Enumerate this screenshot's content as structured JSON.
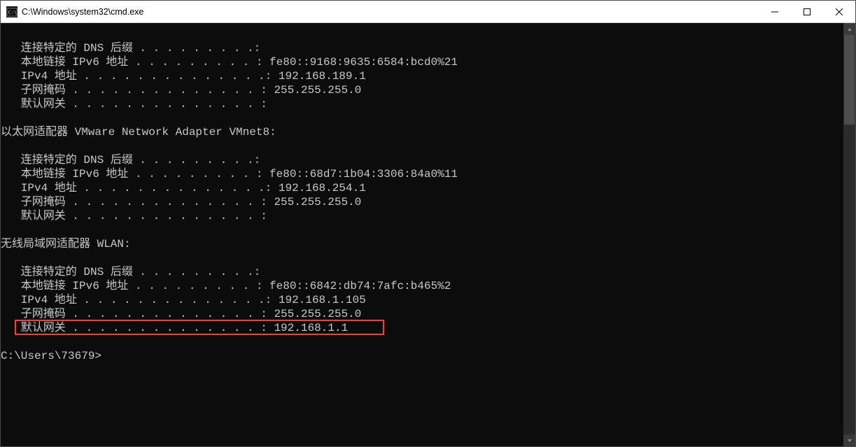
{
  "window": {
    "title": "C:\\Windows\\system32\\cmd.exe"
  },
  "adapters": [
    {
      "header": null,
      "rows": [
        {
          "label": "连接特定的 DNS 后缀",
          "value": ""
        },
        {
          "label": "本地链接 IPv6 地址",
          "value": "fe80::9168:9635:6584:bcd0%21"
        },
        {
          "label": "IPv4 地址",
          "value": "192.168.189.1"
        },
        {
          "label": "子网掩码",
          "value": "255.255.255.0"
        },
        {
          "label": "默认网关",
          "value": ""
        }
      ]
    },
    {
      "header": "以太网适配器 VMware Network Adapter VMnet8:",
      "rows": [
        {
          "label": "连接特定的 DNS 后缀",
          "value": ""
        },
        {
          "label": "本地链接 IPv6 地址",
          "value": "fe80::68d7:1b04:3306:84a0%11"
        },
        {
          "label": "IPv4 地址",
          "value": "192.168.254.1"
        },
        {
          "label": "子网掩码",
          "value": "255.255.255.0"
        },
        {
          "label": "默认网关",
          "value": ""
        }
      ]
    },
    {
      "header": "无线局域网适配器 WLAN:",
      "rows": [
        {
          "label": "连接特定的 DNS 后缀",
          "value": ""
        },
        {
          "label": "本地链接 IPv6 地址",
          "value": "fe80::6842:db74:7afc:b465%2"
        },
        {
          "label": "IPv4 地址",
          "value": "192.168.1.105"
        },
        {
          "label": "子网掩码",
          "value": "255.255.255.0"
        },
        {
          "label": "默认网关",
          "value": "192.168.1.1",
          "highlight": true
        }
      ]
    }
  ],
  "prompt": "C:\\Users\\73679>",
  "layout": {
    "label_display_cols": 20,
    "dot_cols": 16,
    "indent": "   "
  }
}
